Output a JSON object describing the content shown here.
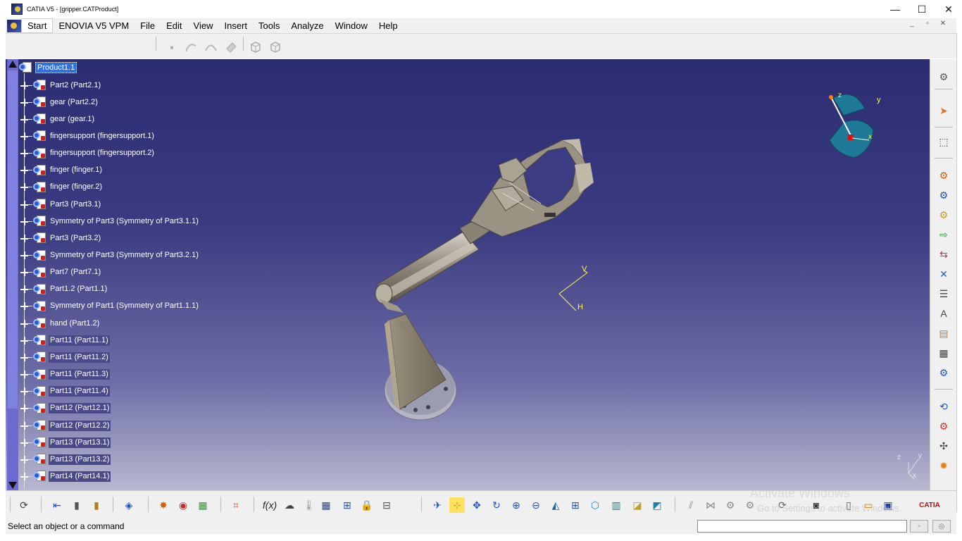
{
  "window": {
    "title": "CATIA V5 - [gripper.CATProduct]",
    "minimize": "—",
    "maximize": "☐",
    "close": "✕"
  },
  "menu": {
    "items": [
      "Start",
      "ENOVIA V5 VPM",
      "File",
      "Edit",
      "View",
      "Insert",
      "Tools",
      "Analyze",
      "Window",
      "Help"
    ],
    "doc_controls": [
      "_",
      "▫",
      "✕"
    ]
  },
  "tree": {
    "root": "Product1.1",
    "nodes": [
      "Part2 (Part2.1)",
      "gear (Part2.2)",
      "gear (gear.1)",
      "fingersupport (fingersupport.1)",
      "fingersupport (fingersupport.2)",
      "finger (finger.1)",
      "finger (finger.2)",
      "Part3 (Part3.1)",
      "Symmetry of Part3 (Symmetry of Part3.1.1)",
      "Part3 (Part3.2)",
      "Symmetry of Part3 (Symmetry of Part3.2.1)",
      "Part7 (Part7.1)",
      "Part1.2 (Part1.1)",
      "Symmetry of Part1 (Symmetry of Part1.1.1)",
      "hand (Part1.2)",
      "Part11 (Part11.1)",
      "Part11 (Part11.2)",
      "Part11 (Part11.3)",
      "Part11 (Part11.4)",
      "Part12 (Part12.1)",
      "Part12 (Part12.2)",
      "Part13 (Part13.1)",
      "Part13 (Part13.2)",
      "Part14 (Part14.1)"
    ]
  },
  "compass": {
    "label_z": "z",
    "label_y": "y",
    "label_x": "x"
  },
  "axis_sketch": {
    "label_v": "V",
    "label_h": "H"
  },
  "corner_axes": {
    "label_z": "z",
    "label_y": "y",
    "label_x": "x"
  },
  "watermark": {
    "line1": "Activate Windows",
    "line2": "Go to Settings to activate Windows."
  },
  "status": {
    "message": "Select an object or a command"
  },
  "brand": {
    "logo_text": "CATIA"
  },
  "colors": {
    "viewport_top": "#2c2c72",
    "viewport_bottom": "#b8b8d0",
    "selection": "#3070e0"
  }
}
